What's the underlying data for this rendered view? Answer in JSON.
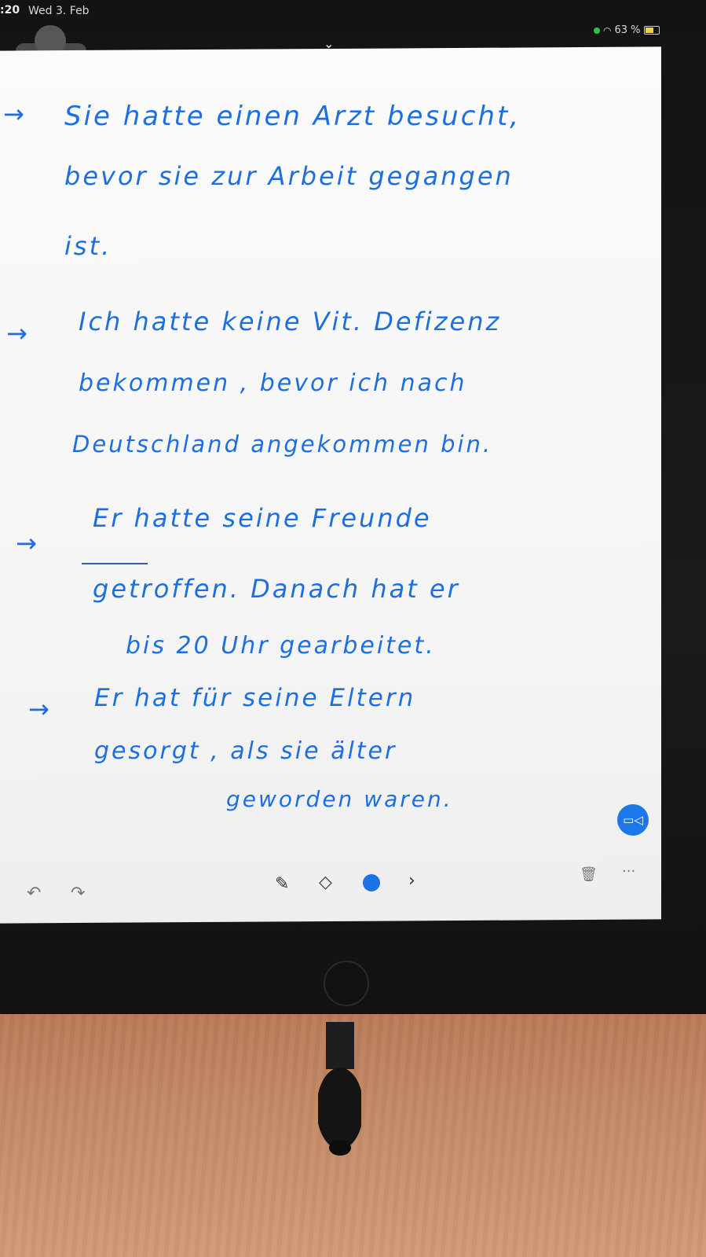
{
  "status_bar": {
    "time": ":20",
    "date": "Wed 3. Feb",
    "battery": "63 %"
  },
  "note_lines": [
    "Sie hatte einen Arzt besucht,",
    "bevor sie zur Arbeit gegangen",
    "ist.",
    "Ich hatte keine Vit. Defizenz",
    "bekommen , bevor ich nach",
    "Deutschland angekommen bin.",
    "Er hatte seine Freunde",
    "getroffen. Danach hat er",
    "bis 20 Uhr gearbeitet.",
    "Er hat für seine Eltern",
    "gesorgt , als sie älter",
    "geworden waren."
  ],
  "arrow_glyph": "→",
  "icons": {
    "undo": "undo-icon",
    "redo": "redo-icon",
    "pencil": "pencil-icon",
    "eraser": "eraser-icon",
    "color": "color-dot-icon",
    "more_tools": "chevron-right-icon",
    "trash": "trash-icon",
    "more": "more-icon",
    "video": "video-icon"
  },
  "colors": {
    "ink": "#1d6fe0",
    "accent": "#1c73e8"
  }
}
